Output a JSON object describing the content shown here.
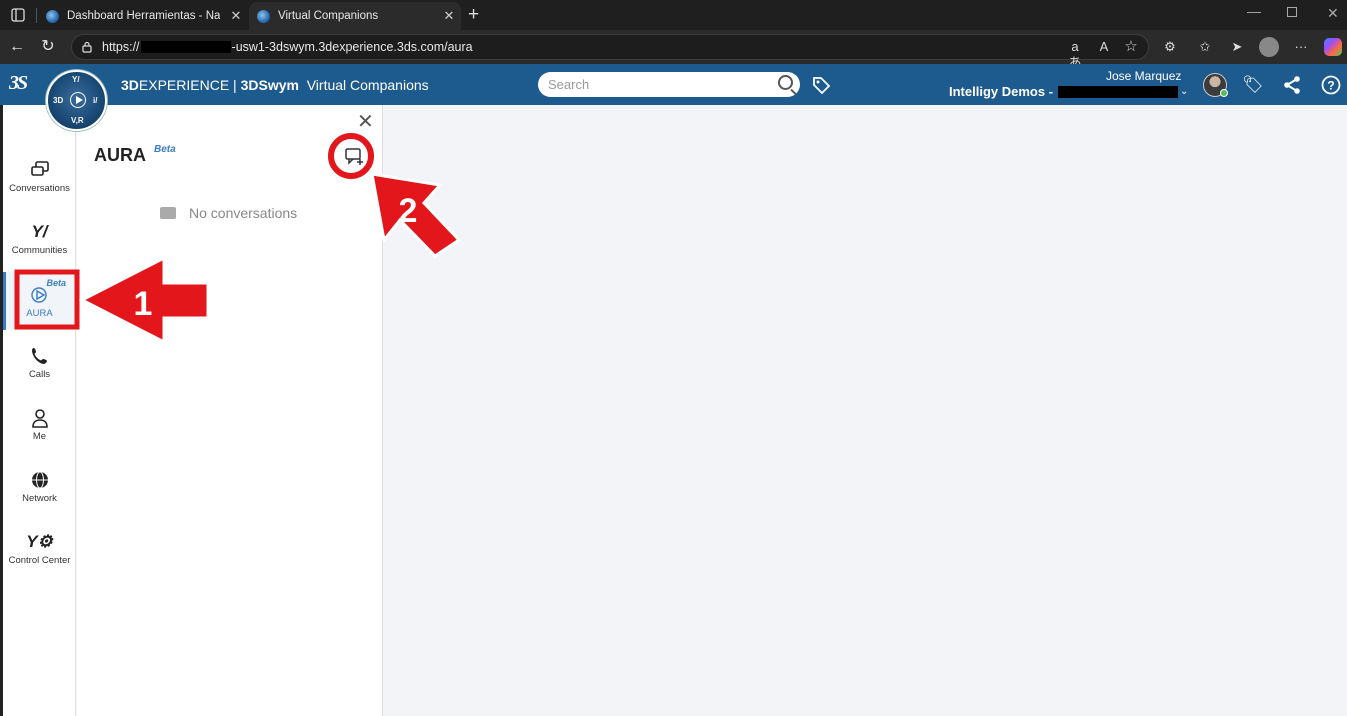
{
  "browser": {
    "tabs": [
      {
        "title": "Dashboard Herramientas - Naveg",
        "active": false
      },
      {
        "title": "Virtual Companions",
        "active": true
      }
    ],
    "url_prefix": "https://",
    "url_suffix": "-usw1-3dswym.3dexperience.3ds.com/aura"
  },
  "app": {
    "logo": "3S",
    "brand_bold": "3D",
    "brand_rest": "EXPERIENCE | ",
    "brand_app": "3DSwym",
    "brand_space": "Virtual Companions",
    "compass_top": "Y/",
    "compass_left": "3D",
    "compass_right": "i/",
    "compass_bottom": "V,R",
    "search_placeholder": "Search",
    "user_name": "Jose Marquez",
    "tenant": "Intelligy Demos -"
  },
  "sidebar": {
    "items": [
      {
        "label": "Conversations",
        "icon": "chat-icon"
      },
      {
        "label": "Communities",
        "icon": "communities-icon"
      },
      {
        "label": "AURA",
        "icon": "aura-icon",
        "badge": "Beta",
        "active": true
      },
      {
        "label": "Calls",
        "icon": "phone-icon"
      },
      {
        "label": "Me",
        "icon": "user-icon"
      },
      {
        "label": "Network",
        "icon": "network-icon"
      },
      {
        "label": "Control Center",
        "icon": "control-center-icon"
      }
    ]
  },
  "panel": {
    "title": "AURA",
    "badge": "Beta",
    "empty_text": "No conversations"
  },
  "annotations": {
    "step1": "1",
    "step2": "2",
    "color": "#e3161c"
  }
}
